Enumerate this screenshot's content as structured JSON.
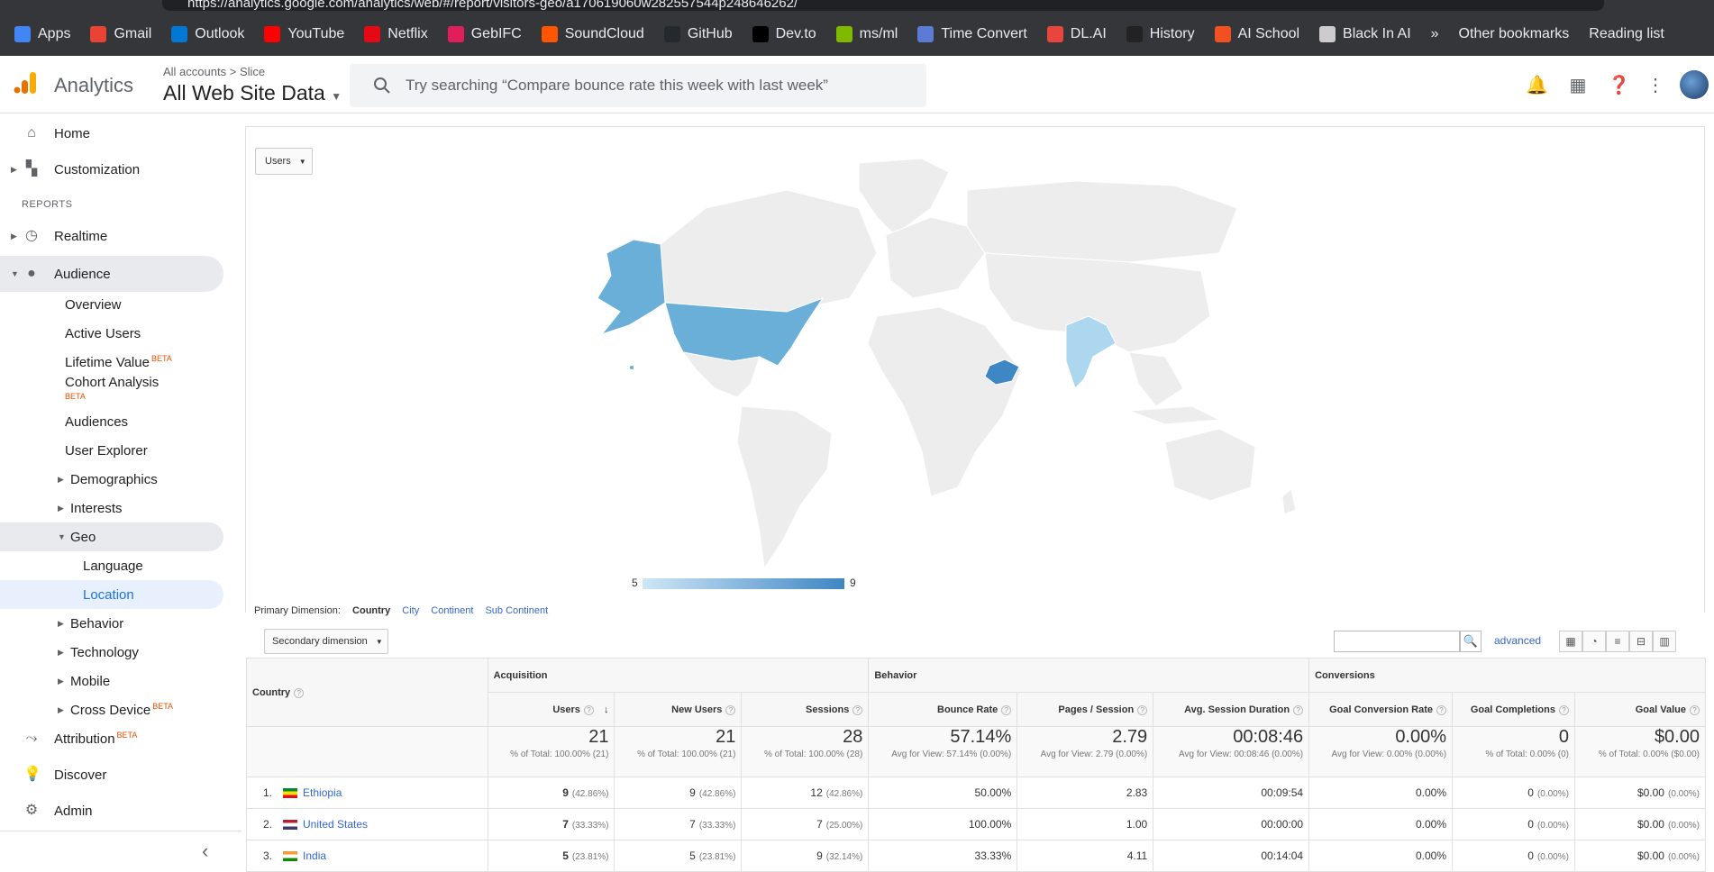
{
  "browser": {
    "url": "https://analytics.google.com/analytics/web/#/report/visitors-geo/a170619060w282557544p248646262/",
    "bookmarks": [
      {
        "label": "Apps",
        "color": "#4285f4"
      },
      {
        "label": "Gmail",
        "color": "#ea4335"
      },
      {
        "label": "Outlook",
        "color": "#0078d4"
      },
      {
        "label": "YouTube",
        "color": "#ff0000"
      },
      {
        "label": "Netflix",
        "color": "#e50914"
      },
      {
        "label": "GebIFC",
        "color": "#e01e5a"
      },
      {
        "label": "SoundCloud",
        "color": "#ff5500"
      },
      {
        "label": "GitHub",
        "color": "#24292e"
      },
      {
        "label": "Dev.to",
        "color": "#000000"
      },
      {
        "label": "ms/ml",
        "color": "#7fba00"
      },
      {
        "label": "Time Convert",
        "color": "#5b7bd5"
      },
      {
        "label": "DL.AI",
        "color": "#e8453c"
      },
      {
        "label": "History",
        "color": "#222222"
      },
      {
        "label": "AI School",
        "color": "#f25022"
      },
      {
        "label": "Black In AI",
        "color": "#cccccc"
      }
    ],
    "more_label": "»",
    "other_bookmarks": "Other bookmarks",
    "reading_list": "Reading list"
  },
  "header": {
    "app_name": "Analytics",
    "crumb_root": "All accounts",
    "crumb_sep": ">",
    "crumb_account": "Slice",
    "property": "All Web Site Data",
    "search_placeholder": "Try searching “Compare bounce rate this week with last week”"
  },
  "sidebar": {
    "home": "Home",
    "customization": "Customization",
    "reports_heading": "REPORTS",
    "realtime": "Realtime",
    "audience": "Audience",
    "audience_items": [
      "Overview",
      "Active Users",
      "Lifetime Value",
      "Cohort Analysis",
      "Audiences",
      "User Explorer",
      "Demographics",
      "Interests",
      "Geo"
    ],
    "beta": "BETA",
    "geo_items": [
      "Language",
      "Location"
    ],
    "more_items": [
      "Behavior",
      "Technology",
      "Mobile",
      "Cross Device"
    ],
    "attribution": "Attribution",
    "discover": "Discover",
    "admin": "Admin",
    "collapse": "‹"
  },
  "map": {
    "metric_dropdown": "Users",
    "legend_min": "5",
    "legend_max": "9",
    "colors": {
      "us": "#6aafd8",
      "ethiopia": "#3f86c4",
      "india": "#add7ef",
      "land": "#ededed"
    }
  },
  "dimension": {
    "label": "Primary Dimension:",
    "active": "Country",
    "options": [
      "City",
      "Continent",
      "Sub Continent"
    ],
    "secondary": "Secondary dimension",
    "advanced": "advanced"
  },
  "table": {
    "country_header": "Country",
    "groups": [
      "Acquisition",
      "Behavior",
      "Conversions"
    ],
    "columns": [
      "Users",
      "New Users",
      "Sessions",
      "Bounce Rate",
      "Pages / Session",
      "Avg. Session Duration",
      "Goal Conversion Rate",
      "Goal Completions",
      "Goal Value"
    ],
    "totals": [
      {
        "value": "21",
        "note": "% of Total: 100.00% (21)"
      },
      {
        "value": "21",
        "note": "% of Total: 100.00% (21)"
      },
      {
        "value": "28",
        "note": "% of Total: 100.00% (28)"
      },
      {
        "value": "57.14%",
        "note": "Avg for View: 57.14% (0.00%)"
      },
      {
        "value": "2.79",
        "note": "Avg for View: 2.79 (0.00%)"
      },
      {
        "value": "00:08:46",
        "note": "Avg for View: 00:08:46 (0.00%)"
      },
      {
        "value": "0.00%",
        "note": "Avg for View: 0.00% (0.00%)"
      },
      {
        "value": "0",
        "note": "% of Total: 0.00% (0)"
      },
      {
        "value": "$0.00",
        "note": "% of Total: 0.00% ($0.00)"
      }
    ],
    "rows": [
      {
        "rank": "1.",
        "country": "Ethiopia",
        "users": "9",
        "users_pct": "(42.86%)",
        "new_users": "9",
        "new_users_pct": "(42.86%)",
        "sessions": "12",
        "sessions_pct": "(42.86%)",
        "bounce": "50.00%",
        "pages": "2.83",
        "duration": "00:09:54",
        "gcr": "0.00%",
        "gc": "0",
        "gc_pct": "(0.00%)",
        "gv": "$0.00",
        "gv_pct": "(0.00%)"
      },
      {
        "rank": "2.",
        "country": "United States",
        "users": "7",
        "users_pct": "(33.33%)",
        "new_users": "7",
        "new_users_pct": "(33.33%)",
        "sessions": "7",
        "sessions_pct": "(25.00%)",
        "bounce": "100.00%",
        "pages": "1.00",
        "duration": "00:00:00",
        "gcr": "0.00%",
        "gc": "0",
        "gc_pct": "(0.00%)",
        "gv": "$0.00",
        "gv_pct": "(0.00%)"
      },
      {
        "rank": "3.",
        "country": "India",
        "users": "5",
        "users_pct": "(23.81%)",
        "new_users": "5",
        "new_users_pct": "(23.81%)",
        "sessions": "9",
        "sessions_pct": "(32.14%)",
        "bounce": "33.33%",
        "pages": "4.11",
        "duration": "00:14:04",
        "gcr": "0.00%",
        "gc": "0",
        "gc_pct": "(0.00%)",
        "gv": "$0.00",
        "gv_pct": "(0.00%)"
      }
    ]
  }
}
